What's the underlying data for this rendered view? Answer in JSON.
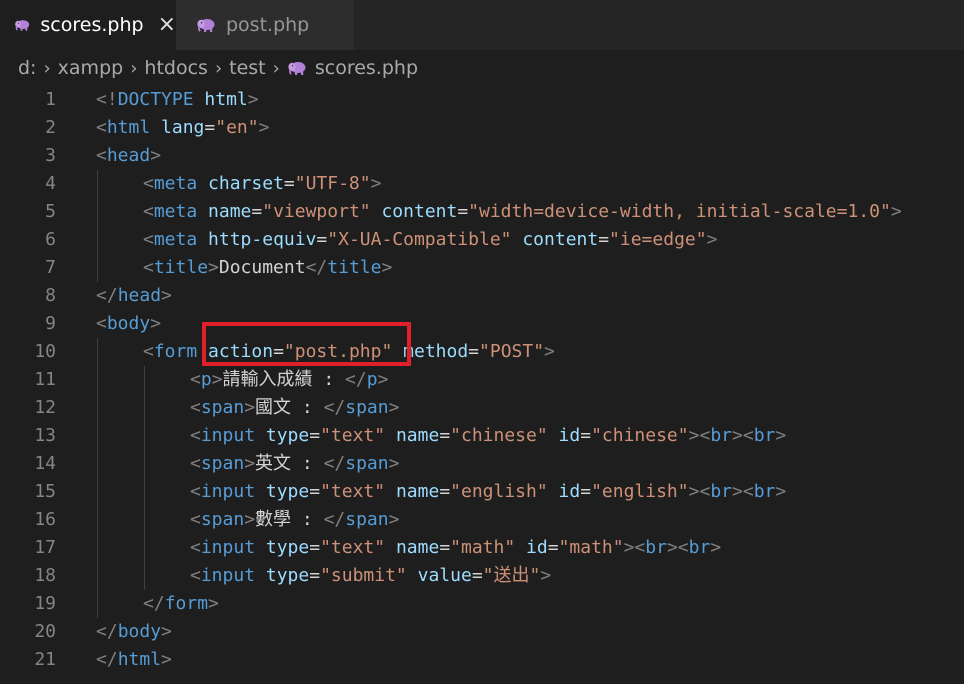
{
  "tabs": [
    {
      "label": "scores.php",
      "active": true,
      "close": "×"
    },
    {
      "label": "post.php",
      "active": false
    }
  ],
  "breadcrumb": [
    "d:",
    "xampp",
    "htdocs",
    "test",
    "scores.php"
  ],
  "colors": {
    "tag": "#569cd6",
    "attr": "#9cdcfe",
    "string": "#ce9178",
    "text": "#d4d4d4",
    "punct": "#808080",
    "highlight": "#e0202a"
  },
  "lines": [
    {
      "n": "1",
      "indent": 0,
      "tokens": [
        [
          "punct",
          "<!"
        ],
        [
          "doc",
          "DOCTYPE"
        ],
        [
          "text",
          " "
        ],
        [
          "attr",
          "html"
        ],
        [
          "punct",
          ">"
        ]
      ]
    },
    {
      "n": "2",
      "indent": 0,
      "tokens": [
        [
          "punct",
          "<"
        ],
        [
          "tag",
          "html"
        ],
        [
          "text",
          " "
        ],
        [
          "attr",
          "lang"
        ],
        [
          "text",
          "="
        ],
        [
          "str",
          "\"en\""
        ],
        [
          "punct",
          ">"
        ]
      ]
    },
    {
      "n": "3",
      "indent": 0,
      "tokens": [
        [
          "punct",
          "<"
        ],
        [
          "tag",
          "head"
        ],
        [
          "punct",
          ">"
        ]
      ]
    },
    {
      "n": "4",
      "indent": 1,
      "tokens": [
        [
          "punct",
          "<"
        ],
        [
          "tag",
          "meta"
        ],
        [
          "text",
          " "
        ],
        [
          "attr",
          "charset"
        ],
        [
          "text",
          "="
        ],
        [
          "str",
          "\"UTF-8\""
        ],
        [
          "punct",
          ">"
        ]
      ]
    },
    {
      "n": "5",
      "indent": 1,
      "tokens": [
        [
          "punct",
          "<"
        ],
        [
          "tag",
          "meta"
        ],
        [
          "text",
          " "
        ],
        [
          "attr",
          "name"
        ],
        [
          "text",
          "="
        ],
        [
          "str",
          "\"viewport\""
        ],
        [
          "text",
          " "
        ],
        [
          "attr",
          "content"
        ],
        [
          "text",
          "="
        ],
        [
          "str",
          "\"width=device-width, initial-scale=1.0\""
        ],
        [
          "punct",
          ">"
        ]
      ]
    },
    {
      "n": "6",
      "indent": 1,
      "tokens": [
        [
          "punct",
          "<"
        ],
        [
          "tag",
          "meta"
        ],
        [
          "text",
          " "
        ],
        [
          "attr",
          "http-equiv"
        ],
        [
          "text",
          "="
        ],
        [
          "str",
          "\"X-UA-Compatible\""
        ],
        [
          "text",
          " "
        ],
        [
          "attr",
          "content"
        ],
        [
          "text",
          "="
        ],
        [
          "str",
          "\"ie=edge\""
        ],
        [
          "punct",
          ">"
        ]
      ]
    },
    {
      "n": "7",
      "indent": 1,
      "tokens": [
        [
          "punct",
          "<"
        ],
        [
          "tag",
          "title"
        ],
        [
          "punct",
          ">"
        ],
        [
          "text",
          "Document"
        ],
        [
          "punct",
          "</"
        ],
        [
          "tag",
          "title"
        ],
        [
          "punct",
          ">"
        ]
      ]
    },
    {
      "n": "8",
      "indent": 0,
      "tokens": [
        [
          "punct",
          "</"
        ],
        [
          "tag",
          "head"
        ],
        [
          "punct",
          ">"
        ]
      ]
    },
    {
      "n": "9",
      "indent": 0,
      "tokens": [
        [
          "punct",
          "<"
        ],
        [
          "tag",
          "body"
        ],
        [
          "punct",
          ">"
        ]
      ]
    },
    {
      "n": "10",
      "indent": 1,
      "tokens": [
        [
          "punct",
          "<"
        ],
        [
          "tag",
          "form"
        ],
        [
          "text",
          " "
        ],
        [
          "attr",
          "action"
        ],
        [
          "text",
          "="
        ],
        [
          "str",
          "\"post.php\""
        ],
        [
          "text",
          " "
        ],
        [
          "attr",
          "method"
        ],
        [
          "text",
          "="
        ],
        [
          "str",
          "\"POST\""
        ],
        [
          "punct",
          ">"
        ]
      ]
    },
    {
      "n": "11",
      "indent": 2,
      "tokens": [
        [
          "punct",
          "<"
        ],
        [
          "tag",
          "p"
        ],
        [
          "punct",
          ">"
        ],
        [
          "text",
          "請輸入成績 : "
        ],
        [
          "punct",
          "</"
        ],
        [
          "tag",
          "p"
        ],
        [
          "punct",
          ">"
        ]
      ]
    },
    {
      "n": "12",
      "indent": 2,
      "tokens": [
        [
          "punct",
          "<"
        ],
        [
          "tag",
          "span"
        ],
        [
          "punct",
          ">"
        ],
        [
          "text",
          "國文 : "
        ],
        [
          "punct",
          "</"
        ],
        [
          "tag",
          "span"
        ],
        [
          "punct",
          ">"
        ]
      ]
    },
    {
      "n": "13",
      "indent": 2,
      "tokens": [
        [
          "punct",
          "<"
        ],
        [
          "tag",
          "input"
        ],
        [
          "text",
          " "
        ],
        [
          "attr",
          "type"
        ],
        [
          "text",
          "="
        ],
        [
          "str",
          "\"text\""
        ],
        [
          "text",
          " "
        ],
        [
          "attr",
          "name"
        ],
        [
          "text",
          "="
        ],
        [
          "str",
          "\"chinese\""
        ],
        [
          "text",
          " "
        ],
        [
          "attr",
          "id"
        ],
        [
          "text",
          "="
        ],
        [
          "str",
          "\"chinese\""
        ],
        [
          "punct",
          "><"
        ],
        [
          "tag",
          "br"
        ],
        [
          "punct",
          "><"
        ],
        [
          "tag",
          "br"
        ],
        [
          "punct",
          ">"
        ]
      ]
    },
    {
      "n": "14",
      "indent": 2,
      "tokens": [
        [
          "punct",
          "<"
        ],
        [
          "tag",
          "span"
        ],
        [
          "punct",
          ">"
        ],
        [
          "text",
          "英文 : "
        ],
        [
          "punct",
          "</"
        ],
        [
          "tag",
          "span"
        ],
        [
          "punct",
          ">"
        ]
      ]
    },
    {
      "n": "15",
      "indent": 2,
      "tokens": [
        [
          "punct",
          "<"
        ],
        [
          "tag",
          "input"
        ],
        [
          "text",
          " "
        ],
        [
          "attr",
          "type"
        ],
        [
          "text",
          "="
        ],
        [
          "str",
          "\"text\""
        ],
        [
          "text",
          " "
        ],
        [
          "attr",
          "name"
        ],
        [
          "text",
          "="
        ],
        [
          "str",
          "\"english\""
        ],
        [
          "text",
          " "
        ],
        [
          "attr",
          "id"
        ],
        [
          "text",
          "="
        ],
        [
          "str",
          "\"english\""
        ],
        [
          "punct",
          "><"
        ],
        [
          "tag",
          "br"
        ],
        [
          "punct",
          "><"
        ],
        [
          "tag",
          "br"
        ],
        [
          "punct",
          ">"
        ]
      ]
    },
    {
      "n": "16",
      "indent": 2,
      "tokens": [
        [
          "punct",
          "<"
        ],
        [
          "tag",
          "span"
        ],
        [
          "punct",
          ">"
        ],
        [
          "text",
          "數學 : "
        ],
        [
          "punct",
          "</"
        ],
        [
          "tag",
          "span"
        ],
        [
          "punct",
          ">"
        ]
      ]
    },
    {
      "n": "17",
      "indent": 2,
      "tokens": [
        [
          "punct",
          "<"
        ],
        [
          "tag",
          "input"
        ],
        [
          "text",
          " "
        ],
        [
          "attr",
          "type"
        ],
        [
          "text",
          "="
        ],
        [
          "str",
          "\"text\""
        ],
        [
          "text",
          " "
        ],
        [
          "attr",
          "name"
        ],
        [
          "text",
          "="
        ],
        [
          "str",
          "\"math\""
        ],
        [
          "text",
          " "
        ],
        [
          "attr",
          "id"
        ],
        [
          "text",
          "="
        ],
        [
          "str",
          "\"math\""
        ],
        [
          "punct",
          "><"
        ],
        [
          "tag",
          "br"
        ],
        [
          "punct",
          "><"
        ],
        [
          "tag",
          "br"
        ],
        [
          "punct",
          ">"
        ]
      ]
    },
    {
      "n": "18",
      "indent": 2,
      "tokens": [
        [
          "punct",
          "<"
        ],
        [
          "tag",
          "input"
        ],
        [
          "text",
          " "
        ],
        [
          "attr",
          "type"
        ],
        [
          "text",
          "="
        ],
        [
          "str",
          "\"submit\""
        ],
        [
          "text",
          " "
        ],
        [
          "attr",
          "value"
        ],
        [
          "text",
          "="
        ],
        [
          "str",
          "\"送出\""
        ],
        [
          "punct",
          ">"
        ]
      ]
    },
    {
      "n": "19",
      "indent": 1,
      "tokens": [
        [
          "punct",
          "</"
        ],
        [
          "tag",
          "form"
        ],
        [
          "punct",
          ">"
        ]
      ]
    },
    {
      "n": "20",
      "indent": 0,
      "tokens": [
        [
          "punct",
          "</"
        ],
        [
          "tag",
          "body"
        ],
        [
          "punct",
          ">"
        ]
      ]
    },
    {
      "n": "21",
      "indent": 0,
      "tokens": [
        [
          "punct",
          "</"
        ],
        [
          "tag",
          "html"
        ],
        [
          "punct",
          ">"
        ]
      ]
    }
  ]
}
